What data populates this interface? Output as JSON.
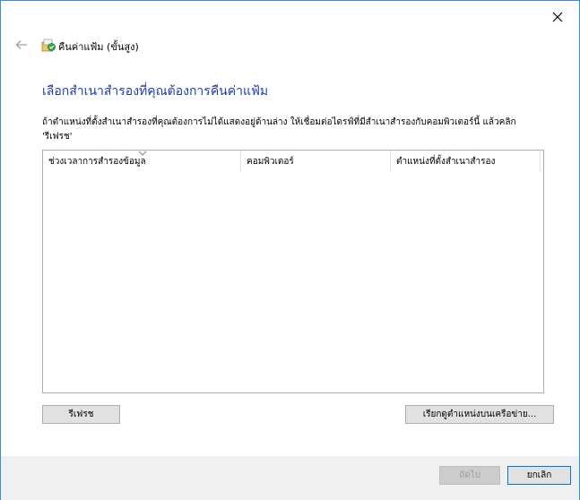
{
  "window": {
    "close_label": "Close"
  },
  "header": {
    "back_label": "Back",
    "app_title": "คืนค่าแฟ้ม (ขั้นสูง)"
  },
  "main": {
    "heading": "เลือกสำเนาสำรองที่คุณต้องการคืนค่าแฟ้ม",
    "description": "ถ้าตำแหน่งที่ตั้งสำเนาสำรองที่คุณต้องการไม่ได้แสดงอยู่ด้านล่าง ให้เชื่อมต่อไดรฟ์ที่มีสำเนาสำรองกับคอมพิวเตอร์นี้ แล้วคลิก 'รีเฟรช'",
    "table": {
      "columns": [
        "ช่วงเวลาการสำรองข้อมูล",
        "คอมพิวเตอร์",
        "ตำแหน่งที่ตั้งสำเนาสำรอง"
      ],
      "sorted_column_index": 0,
      "rows": []
    },
    "refresh_label": "รีเฟรช",
    "browse_label": "เรียกดูตำแหน่งบนเครือข่าย..."
  },
  "footer": {
    "next_label": "ถัดไป",
    "next_enabled": false,
    "cancel_label": "ยกเลิก"
  },
  "colors": {
    "accent": "#0078d7",
    "heading": "#1e3ea8",
    "window_border": "#3c8cdc",
    "footer_bg": "#f0f0f0"
  },
  "icons": {
    "close": "close-icon",
    "back": "back-arrow-icon",
    "app": "restore-files-icon",
    "sort": "sort-indicator-icon"
  }
}
